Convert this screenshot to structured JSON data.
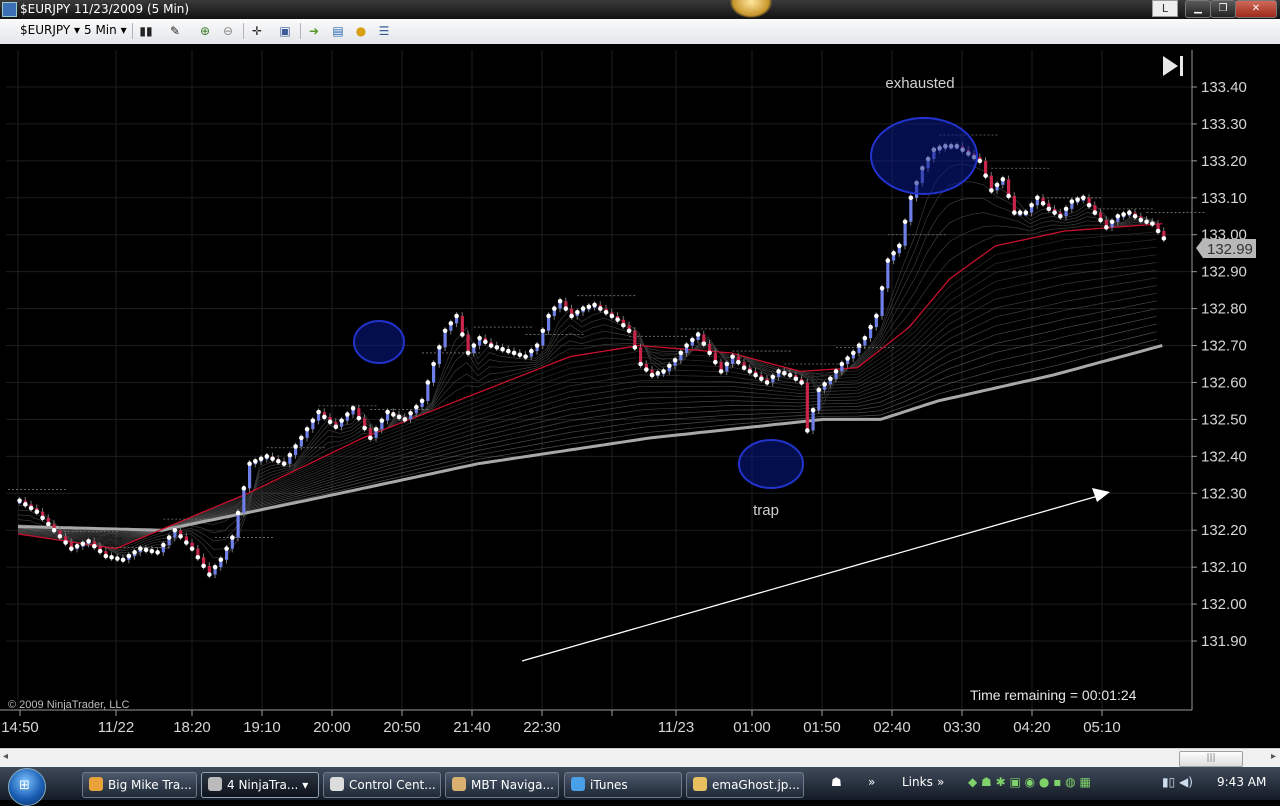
{
  "window": {
    "title": "$EURJPY  11/23/2009 (5 Min)",
    "lang_button": "L",
    "minimize_label": "▁",
    "restore_label": "❐",
    "close_label": "✕"
  },
  "toolbar": {
    "instrument": "$EURJPY",
    "interval": "5 Min",
    "dropdown_glyph": "▾"
  },
  "chart_data": {
    "type": "candlestick",
    "instrument": "$EURJPY",
    "interval": "5 Min",
    "ylim": [
      131.9,
      133.4
    ],
    "y_ticks": [
      "133.40",
      "133.30",
      "133.20",
      "133.10",
      "133.00",
      "132.90",
      "132.80",
      "132.70",
      "132.60",
      "132.50",
      "132.40",
      "132.30",
      "132.20",
      "132.10",
      "132.00",
      "131.90"
    ],
    "x_ticks": [
      "14:50",
      "11/22",
      "18:20",
      "19:10",
      "20:00",
      "20:50",
      "21:40",
      "22:30",
      "11/23",
      "01:00",
      "01:50",
      "02:40",
      "03:30",
      "04:20",
      "05:10"
    ],
    "last_price": "132.99",
    "price_path": [
      [
        0,
        132.28
      ],
      [
        3,
        132.25
      ],
      [
        6,
        132.2
      ],
      [
        9,
        132.15
      ],
      [
        12,
        132.17
      ],
      [
        15,
        132.13
      ],
      [
        18,
        132.12
      ],
      [
        21,
        132.15
      ],
      [
        24,
        132.14
      ],
      [
        27,
        132.2
      ],
      [
        30,
        132.15
      ],
      [
        33,
        132.08
      ],
      [
        35,
        132.12
      ],
      [
        37,
        132.18
      ],
      [
        40,
        132.38
      ],
      [
        43,
        132.4
      ],
      [
        46,
        132.38
      ],
      [
        49,
        132.45
      ],
      [
        52,
        132.52
      ],
      [
        55,
        132.48
      ],
      [
        58,
        132.53
      ],
      [
        61,
        132.45
      ],
      [
        64,
        132.52
      ],
      [
        67,
        132.5
      ],
      [
        70,
        132.55
      ],
      [
        72,
        132.65
      ],
      [
        74,
        132.74
      ],
      [
        76,
        132.78
      ],
      [
        78,
        132.68
      ],
      [
        80,
        132.72
      ],
      [
        82,
        132.7
      ],
      [
        84,
        132.69
      ],
      [
        86,
        132.68
      ],
      [
        88,
        132.67
      ],
      [
        90,
        132.7
      ],
      [
        92,
        132.78
      ],
      [
        94,
        132.82
      ],
      [
        96,
        132.78
      ],
      [
        98,
        132.8
      ],
      [
        100,
        132.81
      ],
      [
        102,
        132.79
      ],
      [
        104,
        132.77
      ],
      [
        106,
        132.74
      ],
      [
        108,
        132.65
      ],
      [
        110,
        132.62
      ],
      [
        112,
        132.63
      ],
      [
        114,
        132.66
      ],
      [
        116,
        132.7
      ],
      [
        118,
        132.73
      ],
      [
        120,
        132.68
      ],
      [
        122,
        132.63
      ],
      [
        124,
        132.67
      ],
      [
        126,
        132.64
      ],
      [
        128,
        132.62
      ],
      [
        130,
        132.6
      ],
      [
        132,
        132.63
      ],
      [
        134,
        132.62
      ],
      [
        136,
        132.6
      ],
      [
        137,
        132.47
      ],
      [
        139,
        132.58
      ],
      [
        141,
        132.61
      ],
      [
        143,
        132.65
      ],
      [
        145,
        132.68
      ],
      [
        147,
        132.72
      ],
      [
        149,
        132.78
      ],
      [
        151,
        132.93
      ],
      [
        153,
        132.97
      ],
      [
        155,
        133.1
      ],
      [
        157,
        133.18
      ],
      [
        159,
        133.23
      ],
      [
        161,
        133.24
      ],
      [
        163,
        133.24
      ],
      [
        165,
        133.22
      ],
      [
        167,
        133.2
      ],
      [
        169,
        133.12
      ],
      [
        171,
        133.15
      ],
      [
        173,
        133.06
      ],
      [
        175,
        133.06
      ],
      [
        177,
        133.1
      ],
      [
        179,
        133.07
      ],
      [
        181,
        133.05
      ],
      [
        183,
        133.09
      ],
      [
        185,
        133.1
      ],
      [
        187,
        133.06
      ],
      [
        189,
        133.02
      ],
      [
        191,
        133.05
      ],
      [
        193,
        133.06
      ],
      [
        195,
        133.04
      ],
      [
        197,
        133.03
      ],
      [
        199,
        132.99
      ]
    ],
    "ema_start": 132.18,
    "red_ema_path": [
      [
        0,
        132.19
      ],
      [
        17,
        132.15
      ],
      [
        40,
        132.3
      ],
      [
        60,
        132.45
      ],
      [
        78,
        132.56
      ],
      [
        96,
        132.67
      ],
      [
        108,
        132.7
      ],
      [
        124,
        132.68
      ],
      [
        136,
        132.63
      ],
      [
        146,
        132.64
      ],
      [
        155,
        132.75
      ],
      [
        162,
        132.88
      ],
      [
        170,
        132.97
      ],
      [
        182,
        133.01
      ],
      [
        199,
        133.03
      ]
    ],
    "slow_ema_path": [
      [
        0,
        132.21
      ],
      [
        25,
        132.2
      ],
      [
        50,
        132.28
      ],
      [
        80,
        132.38
      ],
      [
        110,
        132.45
      ],
      [
        140,
        132.5
      ],
      [
        150,
        132.5
      ],
      [
        160,
        132.55
      ],
      [
        180,
        132.62
      ],
      [
        199,
        132.7
      ]
    ],
    "annotations": [
      {
        "text": "exhausted",
        "x": 920,
        "y": 88
      },
      {
        "text": "trap",
        "x": 766,
        "y": 515
      },
      {
        "text": "© 2009 NinjaTrader, LLC",
        "x": 8,
        "y": 708
      },
      {
        "text": "Time remaining = 00:01:24",
        "x": 970,
        "y": 700
      }
    ],
    "circles": [
      [
        379,
        342,
        25,
        21
      ],
      [
        924,
        156,
        53,
        38
      ],
      [
        771,
        464,
        32,
        24
      ]
    ],
    "trend_arrow": {
      "from": [
        522,
        661
      ],
      "to": [
        1110,
        492
      ]
    },
    "grid": true
  },
  "taskbar": {
    "start_label": "⊞",
    "items": [
      {
        "label": "Big Mike Tra...",
        "color": "#e8a33a"
      },
      {
        "label": "4 NinjaTra...",
        "color": "#bbbbbb"
      },
      {
        "label": "Control Cent...",
        "color": "#dddddd"
      },
      {
        "label": "MBT Naviga...",
        "color": "#d8b070"
      },
      {
        "label": "iTunes",
        "color": "#4aa0e8"
      },
      {
        "label": "emaGhost.jp...",
        "color": "#e8c060"
      }
    ],
    "links_label": "Links",
    "more_glyph": "»",
    "clock": "9:43 AM"
  },
  "scrollbar": {
    "left_arrow": "◂",
    "right_arrow": "▸",
    "grip": "|||"
  }
}
